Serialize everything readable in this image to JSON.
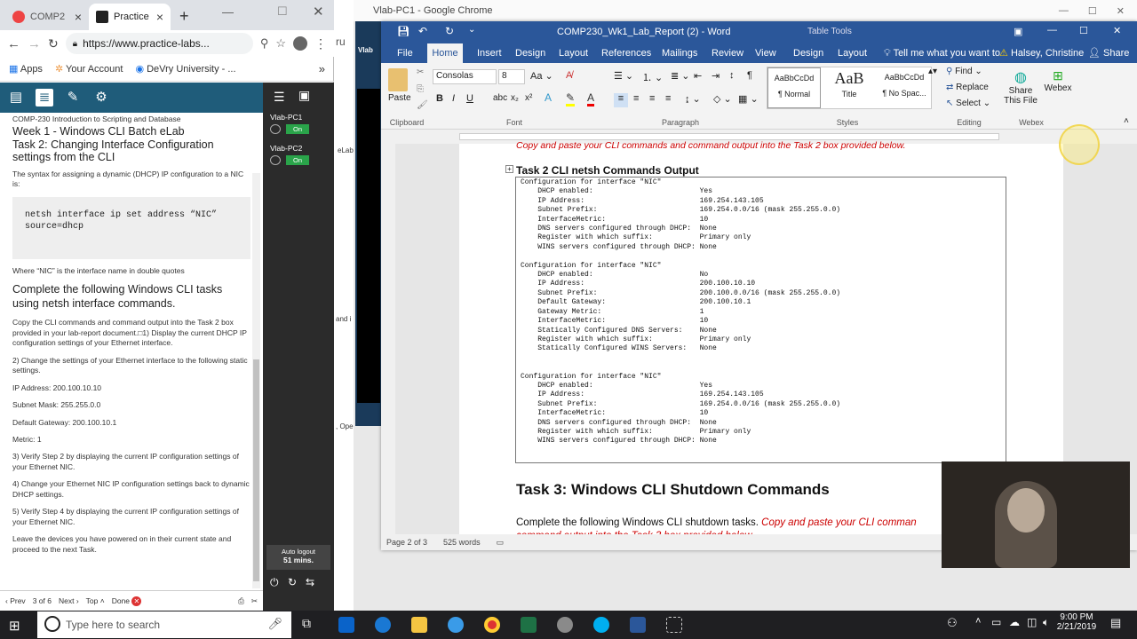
{
  "left_browser": {
    "tabs": [
      {
        "label": "COMP2"
      },
      {
        "label": "Practice"
      }
    ],
    "url": "https://www.practice-labs...",
    "bookmarks": [
      "Apps",
      "Your Account",
      "DeVry University - ..."
    ],
    "more": "»"
  },
  "practice_labs": {
    "course": "COMP-230 Introduction to Scripting and Database",
    "week": "Week 1 - Windows CLI Batch eLab",
    "task": "Task 2: Changing Interface Configuration settings from the CLI",
    "intro": "The syntax for assigning a dynamic (DHCP) IP configuration to a NIC is:",
    "code_line1": "netsh interface ip set address “NIC”",
    "code_line2": "source=dhcp",
    "where": "Where “NIC” is the interface name in double quotes",
    "heading": "Complete the following Windows CLI tasks using netsh interface commands.",
    "steps": [
      "Copy the CLI commands and command output into the Task 2 box provided in your lab-report document.□1) Display the current DHCP IP configuration settings of your Ethernet interface.",
      "2) Change the settings of your Ethernet interface to the following static settings.",
      "IP Address: 200.100.10.10",
      "Subnet Mask: 255.255.0.0",
      "Default Gateway: 200.100.10.1",
      "Metric: 1",
      "3) Verify Step 2 by displaying the current IP configuration settings of your Ethernet NIC.",
      "4) Change your Ethernet NIC IP configuration settings back to dynamic DHCP settings.",
      "5) Verify Step 4 by displaying the current IP configuration settings of your Ethernet NIC.",
      "Leave the devices you have powered on in their current state and proceed to the next Task."
    ],
    "footer": {
      "prev": "Prev",
      "page": "3 of 6",
      "next": "Next",
      "top": "Top",
      "done": "Done"
    },
    "devices": [
      {
        "name": "Vlab-PC1",
        "state": "On"
      },
      {
        "name": "Vlab-PC2",
        "state": "On"
      }
    ],
    "auto_logout": "Auto logout",
    "logout_time": "51 mins."
  },
  "remote": {
    "title": "Vlab-PC1 - Google Chrome",
    "vm_side_text": "Vlab",
    "snippet1": "eLab",
    "snippet2": "and i",
    "snippet3": ", Ope"
  },
  "word": {
    "title": "COMP230_Wk1_Lab_Report (2) - Word",
    "table_tools": "Table Tools",
    "tabs": [
      "File",
      "Home",
      "Insert",
      "Design",
      "Layout",
      "References",
      "Mailings",
      "Review",
      "View",
      "Design",
      "Layout"
    ],
    "tell_me": "Tell me what you want to",
    "user": "Halsey, Christine",
    "share": "Share",
    "font": "Consolas",
    "size": "8",
    "styles": [
      "¶ Normal",
      "Title",
      "¶ No Spac..."
    ],
    "style_samples": [
      "AaBbCcDd",
      "AaB",
      "AaBbCcDd"
    ],
    "editing": [
      "Find",
      "Replace",
      "Select"
    ],
    "groups": [
      "Clipboard",
      "Font",
      "Paragraph",
      "Styles",
      "Editing",
      "Webex"
    ],
    "paste": "Paste",
    "share_file": "Share This File",
    "webex": "Webex",
    "cut_line": "Copy and paste your CLI commands and command output into the Task 2 box provided below.",
    "task2_heading": "Task 2 CLI netsh Commands Output",
    "output": "Configuration for interface \"NIC\"\n    DHCP enabled:                         Yes\n    IP Address:                           169.254.143.105\n    Subnet Prefix:                        169.254.0.0/16 (mask 255.255.0.0)\n    InterfaceMetric:                      10\n    DNS servers configured through DHCP:  None\n    Register with which suffix:           Primary only\n    WINS servers configured through DHCP: None\n\nConfiguration for interface \"NIC\"\n    DHCP enabled:                         No\n    IP Address:                           200.100.10.10\n    Subnet Prefix:                        200.100.0.0/16 (mask 255.255.0.0)\n    Default Gateway:                      200.100.10.1\n    Gateway Metric:                       1\n    InterfaceMetric:                      10\n    Statically Configured DNS Servers:    None\n    Register with which suffix:           Primary only\n    Statically Configured WINS Servers:   None\n\n\nConfiguration for interface \"NIC\"\n    DHCP enabled:                         Yes\n    IP Address:                           169.254.143.105\n    Subnet Prefix:                        169.254.0.0/16 (mask 255.255.0.0)\n    InterfaceMetric:                      10\n    DNS servers configured through DHCP:  None\n    Register with which suffix:           Primary only\n    WINS servers configured through DHCP: None\n\n",
    "task3_heading": "Task 3: Windows CLI Shutdown Commands",
    "task3_text": "Complete the following Windows CLI shutdown tasks.",
    "task3_red": "Copy and paste your CLI comman",
    "task3_red2": "command output into the Task 3 box provided below.",
    "status_page": "Page 2 of 3",
    "status_words": "525 words"
  },
  "taskbar": {
    "search": "Type here to search",
    "time": "9:00 PM",
    "date": "2/21/2019"
  }
}
